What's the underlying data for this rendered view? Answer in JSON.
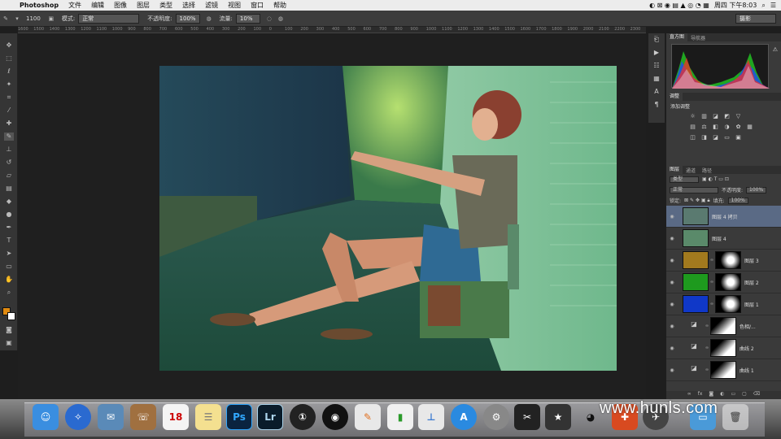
{
  "menubar": {
    "apple": "",
    "app_name": "Photoshop",
    "items": [
      "文件",
      "编辑",
      "图像",
      "图层",
      "类型",
      "选择",
      "滤镜",
      "视图",
      "窗口",
      "帮助"
    ],
    "clock": "周四 下午8:03"
  },
  "options": {
    "brush_size": "1100",
    "mode_label": "模式:",
    "mode_value": "正常",
    "opacity_label": "不透明度:",
    "opacity_value": "100%",
    "flow_label": "流量:",
    "flow_value": "10%",
    "workspace": "摄影"
  },
  "ruler": {
    "ticks": [
      "1600",
      "1500",
      "1400",
      "1300",
      "1200",
      "1100",
      "1000",
      "900",
      "800",
      "700",
      "600",
      "500",
      "400",
      "300",
      "200",
      "100",
      "0",
      "100",
      "200",
      "300",
      "400",
      "500",
      "600",
      "700",
      "800",
      "900",
      "1000",
      "1100",
      "1200",
      "1300",
      "1400",
      "1500",
      "1600",
      "1700",
      "1800",
      "1900",
      "2000",
      "2100",
      "2200",
      "2300",
      "2400",
      "2500",
      "2600",
      "2700",
      "2800",
      "2900",
      "3000",
      "3100",
      "3200",
      "3300",
      "3400",
      "3500",
      "3600",
      "3700",
      "3800",
      "3900",
      "4000",
      "4100",
      "4200",
      "4300",
      "4400",
      "4500",
      "4600",
      "4700",
      "4800",
      "4900",
      "5000",
      "5100",
      "5200",
      "5300",
      "5400",
      "5500",
      "5600",
      "5700",
      "5800",
      "5900"
    ]
  },
  "panels": {
    "histogram_tab": "直方图",
    "navigator_tab": "导航器",
    "adjust_tab": "调整",
    "adjust_title": "添加调整",
    "layers_tab": "图层",
    "channels_tab": "通道",
    "paths_tab": "路径",
    "kind_label": "类型",
    "blend_mode": "正常",
    "opacity_label": "不透明度:",
    "opacity_value": "100%",
    "lock_label": "锁定:",
    "fill_label": "填充:",
    "fill_value": "100%"
  },
  "layers": [
    {
      "name": "图层 4 拷贝",
      "color": "#5a7a70",
      "mask": false
    },
    {
      "name": "图层 4",
      "color": "#5a8a6a",
      "mask": false
    },
    {
      "name": "图层 3",
      "color": "#a27a1e",
      "mask": true
    },
    {
      "name": "图层 2",
      "color": "#1e9a1e",
      "mask": true
    },
    {
      "name": "图层 1",
      "color": "#1038c8",
      "mask": true
    },
    {
      "name": "色相/...",
      "color": null,
      "mask": true
    },
    {
      "name": "曲线 2",
      "color": null,
      "mask": true
    },
    {
      "name": "曲线 1",
      "color": null,
      "mask": true
    }
  ],
  "dock": {
    "apps": [
      "Finder",
      "Safari",
      "Mail",
      "Contacts",
      "Calendar",
      "Notes",
      "Ps",
      "Lr",
      "",
      "",
      "",
      "",
      "",
      "",
      "",
      "",
      "",
      "",
      "",
      "",
      ""
    ],
    "calendar_day": "18"
  },
  "watermark": "www.hunls.com",
  "colors": {
    "foreground": "#e08a10",
    "background": "#ffffff",
    "accent_selected": "#5a6a85"
  }
}
